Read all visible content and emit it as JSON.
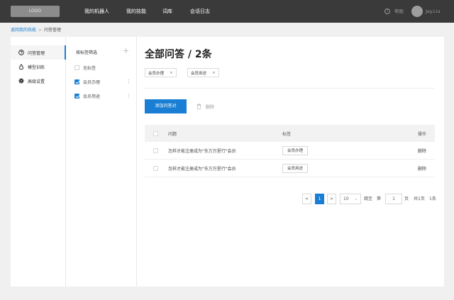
{
  "header": {
    "logo": "LOGO",
    "nav": [
      "我的机器人",
      "我的技能",
      "词库",
      "会话日志"
    ],
    "help_label": "帮助",
    "username": "Jay.Liu"
  },
  "breadcrumb": {
    "back_link": "返回我的技能",
    "separator": ">",
    "current": "问答管理"
  },
  "sidebar": {
    "items": [
      {
        "label": "问答管理",
        "icon": "question-circle-icon",
        "active": true
      },
      {
        "label": "模型训练",
        "icon": "recycle-icon",
        "active": false
      },
      {
        "label": "高级设置",
        "icon": "gear-icon",
        "active": false
      }
    ]
  },
  "filter": {
    "title": "按标签筛选",
    "add_icon": "plus-icon",
    "tags": [
      {
        "label": "无标签",
        "checked": false
      },
      {
        "label": "会员办理",
        "checked": true
      },
      {
        "label": "会员用途",
        "checked": true
      }
    ]
  },
  "main": {
    "heading": "全部问答 / 2条",
    "active_chips": [
      "会员办理",
      "会员用途"
    ],
    "chip_close": "×",
    "add_button": "添加问答对",
    "delete_label": "删除",
    "table": {
      "columns": [
        "问题",
        "标签",
        "操作"
      ],
      "rows": [
        {
          "question": "怎样才能注册成为\"东方万里行\"会员",
          "tag": "会员办理",
          "action": "删除"
        },
        {
          "question": "怎样才能注册成为\"东方万里行\"会员",
          "tag": "会员用途",
          "action": "删除"
        }
      ]
    },
    "pagination": {
      "prev": "<",
      "current_page": "1",
      "next": ">",
      "page_size": "10",
      "jump_label": "跳至",
      "page_prefix": "第",
      "page_input": "1",
      "page_suffix": "页",
      "total_pages": "共1页",
      "total_items": "1条"
    }
  },
  "colors": {
    "accent": "#1a7fd4",
    "topbar": "#3a3a3a"
  }
}
